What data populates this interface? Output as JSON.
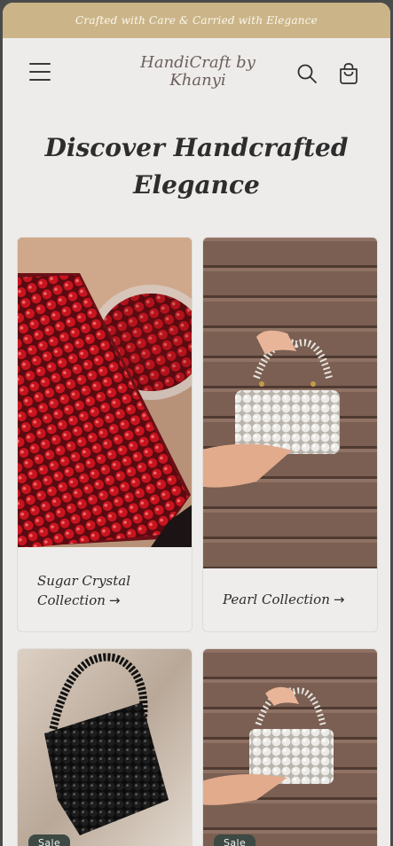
{
  "announcement": {
    "text": "Crafted with Care & Carried with Elegance"
  },
  "header": {
    "logo_line1": "HandiCraft by",
    "logo_line2": "Khanyi",
    "icons": [
      "menu-icon",
      "search-icon",
      "cart-icon"
    ]
  },
  "hero": {
    "title_line1": "Discover Handcrafted",
    "title_line2": "Elegance"
  },
  "collections": [
    {
      "title_line1": "Sugar Crystal",
      "title_line2": "Collection",
      "arrow": "→"
    },
    {
      "title": "Pearl Collection",
      "arrow": "→"
    }
  ],
  "products": [
    {
      "badge": "Sale"
    },
    {
      "badge": "Sale"
    }
  ],
  "colors": {
    "announcement_bg": "#cbb588",
    "page_bg": "#eeecea",
    "badge_bg": "#3c4a43",
    "text_dark": "#2d2d2d"
  }
}
